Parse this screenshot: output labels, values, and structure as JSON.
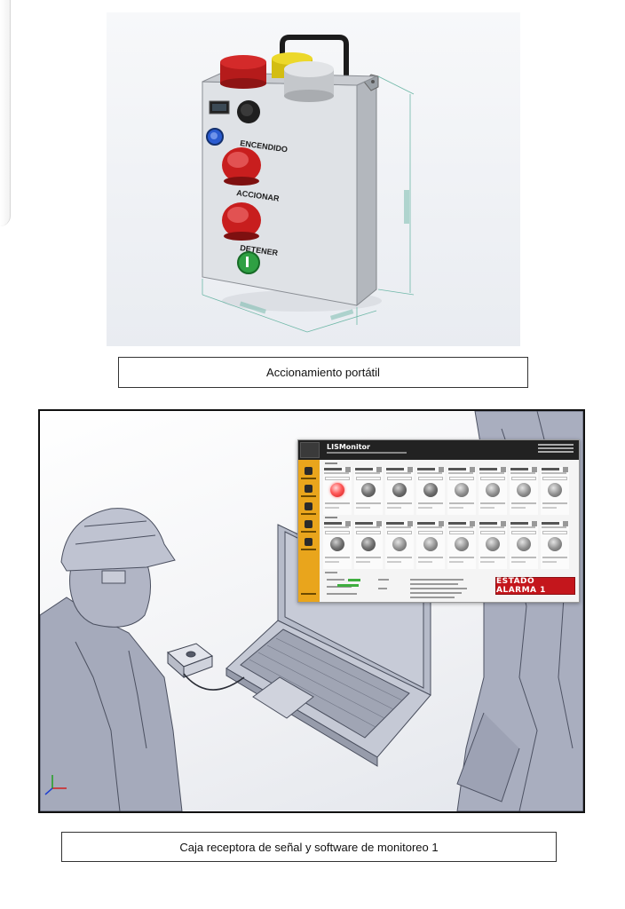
{
  "figure1": {
    "caption": "Accionamiento portátil",
    "box_labels": {
      "label_top": "ENCENDIDO",
      "label_middle": "ACCIONAR",
      "label_bottom": "DETENER"
    }
  },
  "figure2": {
    "caption": "Caja receptora de señal y software de monitoreo 1",
    "monitor": {
      "title": "LISMonitor",
      "alarm_text": "ESTADO ALARMA 1"
    }
  },
  "colors": {
    "alarm_red": "#c4161c",
    "sidebar_orange": "#e9a51c",
    "button_red": "#c81e1e",
    "beacon_yellow": "#e8d21c",
    "green_button": "#2fa043"
  }
}
